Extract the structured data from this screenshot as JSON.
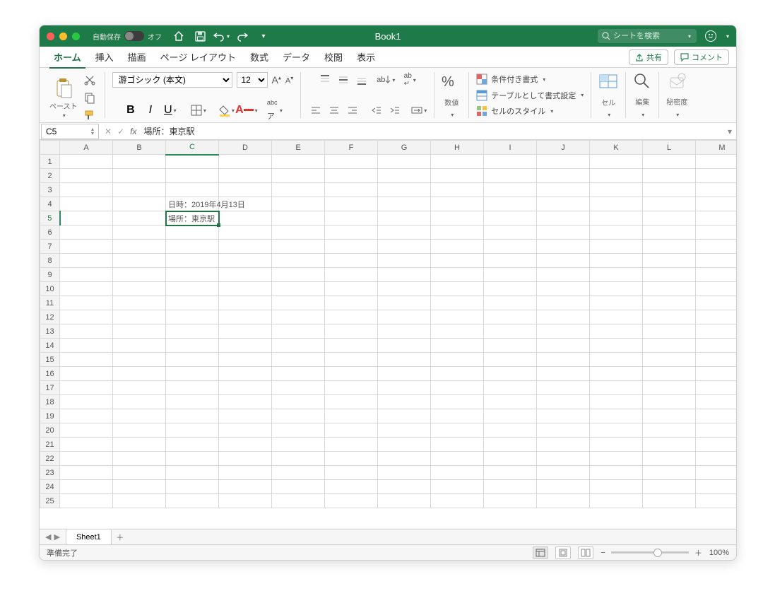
{
  "titlebar": {
    "autosave_label": "自動保存",
    "autosave_state": "オフ",
    "title": "Book1",
    "search_placeholder": "シートを検索"
  },
  "tabs": {
    "items": [
      "ホーム",
      "挿入",
      "描画",
      "ページ レイアウト",
      "数式",
      "データ",
      "校閲",
      "表示"
    ],
    "active": 0,
    "share": "共有",
    "comment": "コメント"
  },
  "ribbon": {
    "paste": "ペースト",
    "font_name": "游ゴシック (本文)",
    "font_size": "12",
    "number_label": "数値",
    "cond_fmt": "条件付き書式",
    "table_fmt": "テーブルとして書式設定",
    "cell_styles": "セルのスタイル",
    "cells_label": "セル",
    "edit_label": "編集",
    "confidential": "秘密度"
  },
  "formula_bar": {
    "name_box": "C5",
    "formula": "場所：東京駅"
  },
  "grid": {
    "columns": [
      "A",
      "B",
      "C",
      "D",
      "E",
      "F",
      "G",
      "H",
      "I",
      "J",
      "K",
      "L",
      "M"
    ],
    "rows": 25,
    "cells": {
      "C4": "日時：2019年4月13日",
      "C5": "場所：東京駅"
    },
    "active_cell": "C5"
  },
  "sheetbar": {
    "active_sheet": "Sheet1"
  },
  "status": {
    "ready": "準備完了",
    "zoom": "100%"
  }
}
